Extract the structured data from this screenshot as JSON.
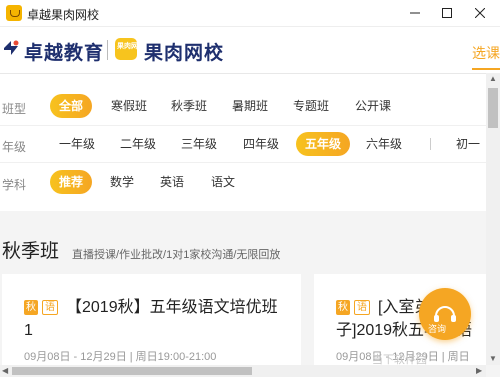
{
  "window": {
    "title": "卓越果肉网校"
  },
  "header": {
    "brand1": "卓越教育",
    "badge_text": "果肉网校",
    "brand2": "果肉网校",
    "nav_select": "选课"
  },
  "filters": {
    "type": {
      "label": "班型",
      "options": [
        "全部",
        "寒假班",
        "秋季班",
        "暑期班",
        "专题班",
        "公开课"
      ],
      "active_index": 0
    },
    "grade": {
      "label": "年级",
      "options": [
        "一年级",
        "二年级",
        "三年级",
        "四年级",
        "五年级",
        "六年级",
        "初一"
      ],
      "active_index": 4
    },
    "subject": {
      "label": "学科",
      "options": [
        "推荐",
        "数学",
        "英语",
        "语文"
      ],
      "active_index": 0
    }
  },
  "section": {
    "title": "秋季班",
    "subtitle": "直播授课/作业批改/1对1家校沟通/无限回放"
  },
  "cards": [
    {
      "tag_season": "秋",
      "tag_subject": "语",
      "title": "【2019秋】五年级语文培优班1",
      "meta": "09月08日 - 12月29日 | 周日19:00-21:00"
    },
    {
      "tag_season": "秋",
      "tag_subject": "语",
      "title": "[入室弟子]2019秋五年级语文培优班1",
      "meta": "09月08日 - 12月29日 | 周日"
    }
  ],
  "float_button": {
    "label": "咨询"
  },
  "watermark": "当下软件园",
  "colors": {
    "accent": "#f5a623",
    "brand": "#1e2f6e"
  }
}
